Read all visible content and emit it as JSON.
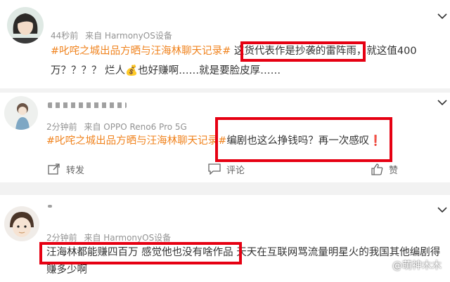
{
  "posts": [
    {
      "time": "44秒前",
      "source": "来自 HarmonyOS设备",
      "line1": {
        "tag": "#叱咤之城出品方晒与汪海林聊天记录#",
        "pre": " 这",
        "highlighted": "货代表作是抄袭的雷阵雨，",
        "post": "就这值400"
      },
      "line2": "万？？？？ 烂人💰也好赚啊……就是要脸皮厚……"
    },
    {
      "time": "2分钟前",
      "source": "来自 OPPO Reno6 Pro 5G",
      "tag": "#叱咤之城出品方晒与汪海林聊天记录#",
      "highlighted": "编剧也这么挣钱吗？再一次感叹❗",
      "actions": {
        "repost": "转发",
        "comment": "评论",
        "like": "赞"
      }
    },
    {
      "time": "2分钟前",
      "source": "来自 HarmonyOS设备",
      "highlighted": "汪海林都能赚四百万 感觉他也没有啥作品",
      "rest": " 天天在互联网骂流量明星火的我国其他编剧得",
      "line2": "赚多少啊"
    }
  ],
  "watermark": "@萌神木木",
  "colors": {
    "tag": "#f0831e",
    "highlight_box": "#e60012",
    "meta": "#939393"
  }
}
